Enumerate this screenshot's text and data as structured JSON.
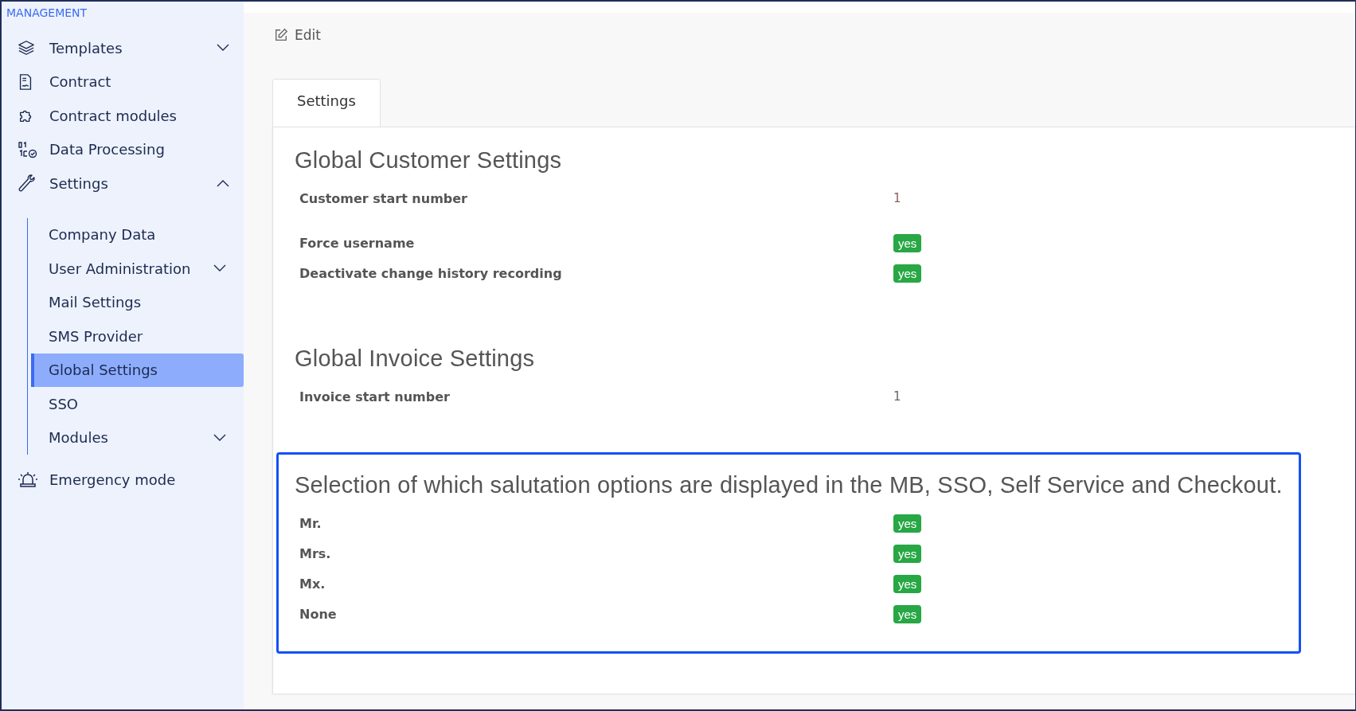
{
  "sidebar": {
    "heading": "MANAGEMENT",
    "items": [
      {
        "label": "Templates",
        "expanded": false,
        "selected": false
      },
      {
        "label": "Contract",
        "selected": false
      },
      {
        "label": "Contract modules",
        "selected": false
      },
      {
        "label": "Data Processing",
        "selected": false
      },
      {
        "label": "Settings",
        "expanded": true,
        "selected": false,
        "children": [
          {
            "label": "Company Data",
            "selected": false
          },
          {
            "label": "User Administration",
            "expanded": false,
            "selected": false
          },
          {
            "label": "Mail Settings",
            "selected": false
          },
          {
            "label": "SMS Provider",
            "selected": false
          },
          {
            "label": "Global Settings",
            "selected": true
          },
          {
            "label": "SSO",
            "selected": false
          },
          {
            "label": "Modules",
            "expanded": false,
            "selected": false
          }
        ]
      },
      {
        "label": "Emergency mode",
        "selected": false
      }
    ]
  },
  "toolbar": {
    "edit": "Edit"
  },
  "tabs": [
    {
      "label": "Settings",
      "selected": true
    }
  ],
  "sections": [
    {
      "title": "Global Customer Settings",
      "highlighted": false,
      "groups": [
        [
          {
            "label": "Customer start number",
            "kind": "text",
            "value": "1"
          }
        ],
        [
          {
            "label": "Force username",
            "kind": "badge",
            "value": "yes"
          },
          {
            "label": "Deactivate change history recording",
            "kind": "badge",
            "value": "yes"
          }
        ]
      ]
    },
    {
      "title": "Global Invoice Settings",
      "highlighted": false,
      "groups": [
        [
          {
            "label": "Invoice start number",
            "kind": "text",
            "value": "1"
          }
        ]
      ]
    },
    {
      "title": "Selection of which salutation options are displayed in the MB, SSO, Self Service and Checkout.",
      "highlighted": true,
      "groups": [
        [
          {
            "label": "Mr.",
            "kind": "badge",
            "value": "yes"
          },
          {
            "label": "Mrs.",
            "kind": "badge",
            "value": "yes"
          },
          {
            "label": "Mx.",
            "kind": "badge",
            "value": "yes"
          },
          {
            "label": "None",
            "kind": "badge",
            "value": "yes"
          }
        ]
      ]
    }
  ]
}
